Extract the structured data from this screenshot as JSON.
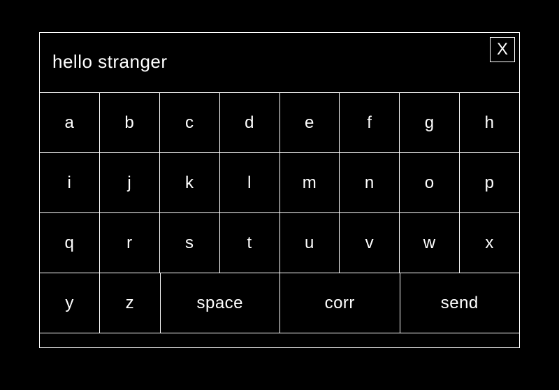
{
  "display": {
    "text": "hello stranger",
    "close_label": "X"
  },
  "keys": {
    "row1": [
      "a",
      "b",
      "c",
      "d",
      "e",
      "f",
      "g",
      "h"
    ],
    "row2": [
      "i",
      "j",
      "k",
      "l",
      "m",
      "n",
      "o",
      "p"
    ],
    "row3": [
      "q",
      "r",
      "s",
      "t",
      "u",
      "v",
      "w",
      "x"
    ],
    "row4": {
      "y": "y",
      "z": "z",
      "space": "space",
      "corr": "corr",
      "send": "send"
    }
  }
}
